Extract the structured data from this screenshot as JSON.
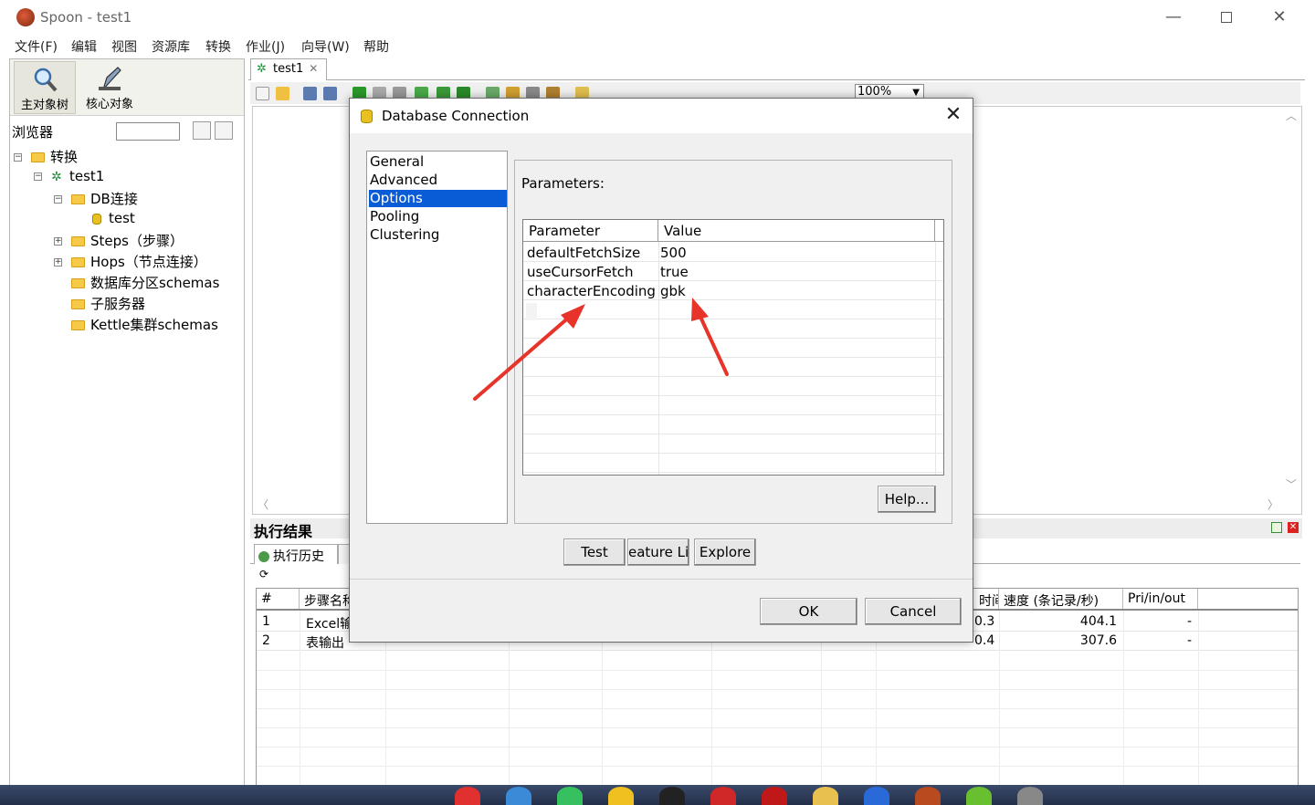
{
  "window": {
    "title": "Spoon - test1"
  },
  "menu": [
    "文件(F)",
    "编辑",
    "视图",
    "资源库",
    "转换",
    "作业(J)",
    "向导(W)",
    "帮助"
  ],
  "left_panel": {
    "perspectives": [
      {
        "label": "主对象树",
        "icon": "magnifier-icon"
      },
      {
        "label": "核心对象",
        "icon": "pencil-icon"
      }
    ],
    "browser_label": "浏览器",
    "tree": [
      {
        "label": "转换",
        "level": 0,
        "expander": "−",
        "icon": "folder-icon"
      },
      {
        "label": "test1",
        "level": 1,
        "expander": "−",
        "icon": "transform-icon"
      },
      {
        "label": "DB连接",
        "level": 2,
        "expander": "−",
        "icon": "folder-icon"
      },
      {
        "label": "test",
        "level": 3,
        "expander": "",
        "icon": "database-icon"
      },
      {
        "label": "Steps（步骤）",
        "level": 2,
        "expander": "+",
        "icon": "folder-icon"
      },
      {
        "label": "Hops（节点连接）",
        "level": 2,
        "expander": "+",
        "icon": "folder-icon"
      },
      {
        "label": "数据库分区schemas",
        "level": 2,
        "expander": "",
        "icon": "folder-icon"
      },
      {
        "label": "子服务器",
        "level": 2,
        "expander": "",
        "icon": "folder-icon"
      },
      {
        "label": "Kettle集群schemas",
        "level": 2,
        "expander": "",
        "icon": "folder-icon"
      }
    ]
  },
  "workspace": {
    "file_tab": "test1",
    "zoom": "100%",
    "results_title": "执行结果",
    "results_tab": "执行历史",
    "grid_headers": [
      "#",
      "步骤名称",
      "",
      "",
      "",
      "",
      "",
      "",
      "",
      "",
      "时间",
      "速度 (条记录/秒)",
      "Pri/in/out"
    ],
    "grid_rows": [
      {
        "num": "1",
        "name": "Excel输",
        "time": "0.3",
        "speed": "404.1",
        "pio": "-"
      },
      {
        "num": "2",
        "name": "表输出",
        "time": "0.4",
        "speed": "307.6",
        "pio": "-"
      }
    ]
  },
  "dialog": {
    "title": "Database Connection",
    "nav": [
      {
        "label": "General",
        "selected": false
      },
      {
        "label": "Advanced",
        "selected": false
      },
      {
        "label": "Options",
        "selected": true
      },
      {
        "label": "Pooling",
        "selected": false
      },
      {
        "label": "Clustering",
        "selected": false
      }
    ],
    "params_label": "Parameters:",
    "table_headers": {
      "parameter": "Parameter",
      "value": "Value"
    },
    "params": [
      {
        "parameter": "defaultFetchSize",
        "value": "500"
      },
      {
        "parameter": "useCursorFetch",
        "value": "true"
      },
      {
        "parameter": "characterEncoding",
        "value": "gbk"
      }
    ],
    "buttons": {
      "help": "Help...",
      "test": "Test",
      "feature_list": "eature Li",
      "explore": "Explore",
      "ok": "OK",
      "cancel": "Cancel"
    }
  },
  "colors": {
    "selection": "#0a5cd6",
    "annotation_arrow": "#e8332a"
  }
}
